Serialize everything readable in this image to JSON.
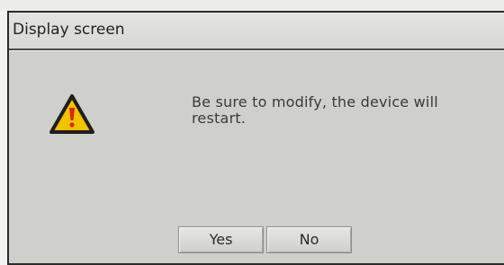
{
  "dialog": {
    "title": "Display screen",
    "message": "Be sure to modify, the device will restart.",
    "icon": "warning-icon",
    "buttons": {
      "yes_label": "Yes",
      "no_label": "No"
    }
  },
  "colors": {
    "dialog_background": "#cfcfcb",
    "warning_fill": "#f2c200",
    "warning_mark": "#d42a1a"
  }
}
